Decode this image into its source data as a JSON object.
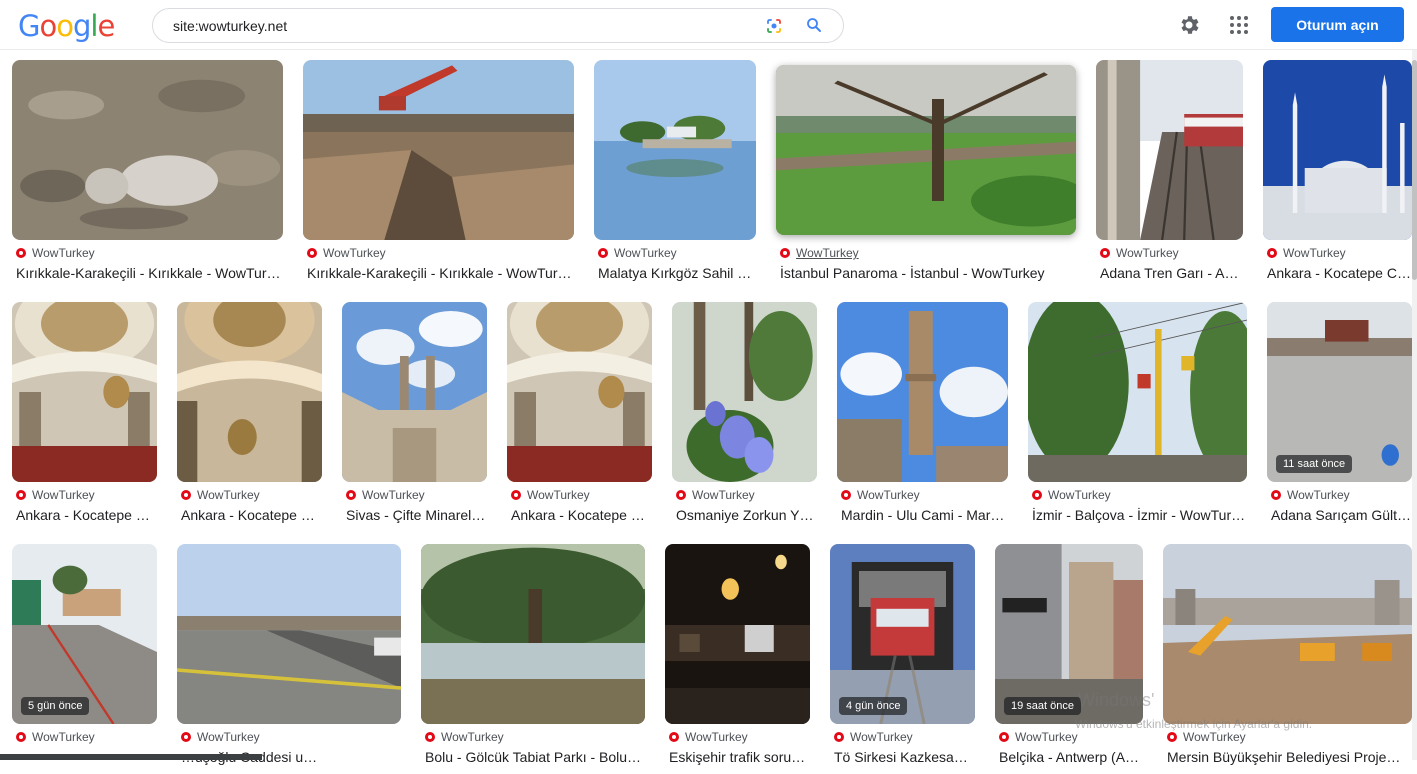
{
  "search": {
    "query": "site:wowturkey.net"
  },
  "header": {
    "logo": "Google",
    "signin_label": "Oturum açın"
  },
  "results": [
    {
      "source": "WowTurkey",
      "title": "Kırıkkale-Karakeçili - Kırıkkale - WowTur…",
      "badge": ""
    },
    {
      "source": "WowTurkey",
      "title": "Kırıkkale-Karakeçili - Kırıkkale - WowTur…",
      "badge": ""
    },
    {
      "source": "WowTurkey",
      "title": "Malatya Kırkgöz Sahil …",
      "badge": ""
    },
    {
      "source": "WowTurkey",
      "title": "İstanbul Panaroma - İstanbul - WowTurkey",
      "badge": ""
    },
    {
      "source": "WowTurkey",
      "title": "Adana Tren Garı - A…",
      "badge": ""
    },
    {
      "source": "WowTurkey",
      "title": "Ankara - Kocatepe C…",
      "badge": ""
    },
    {
      "source": "WowTurkey",
      "title": "Ankara - Kocatepe …",
      "badge": ""
    },
    {
      "source": "WowTurkey",
      "title": "Ankara - Kocatepe …",
      "badge": ""
    },
    {
      "source": "WowTurkey",
      "title": "Sivas - Çifte Minarel…",
      "badge": ""
    },
    {
      "source": "WowTurkey",
      "title": "Ankara - Kocatepe …",
      "badge": ""
    },
    {
      "source": "WowTurkey",
      "title": "Osmaniye Zorkun Y…",
      "badge": ""
    },
    {
      "source": "WowTurkey",
      "title": "Mardin - Ulu Cami - Mar…",
      "badge": ""
    },
    {
      "source": "WowTurkey",
      "title": "İzmir - Balçova - İzmir - WowTur…",
      "badge": ""
    },
    {
      "source": "WowTurkey",
      "title": "Adana Sarıçam Gült…",
      "badge": "11 saat önce"
    },
    {
      "source": "WowTurkey",
      "title": "",
      "badge": "5 gün önce"
    },
    {
      "source": "WowTurkey",
      "title": "…uşoğlu Caddesi u…",
      "badge": ""
    },
    {
      "source": "WowTurkey",
      "title": "Bolu - Gölcük Tabiat Parkı - Bolu…",
      "badge": ""
    },
    {
      "source": "WowTurkey",
      "title": "Eskişehir trafik soru…",
      "badge": ""
    },
    {
      "source": "WowTurkey",
      "title": "Tö Sirkesi Kazkesa…",
      "badge": "4 gün önce"
    },
    {
      "source": "WowTurkey",
      "title": "Belçika - Antwerp (A…",
      "badge": "19 saat önce"
    },
    {
      "source": "WowTurkey",
      "title": "Mersin Büyükşehir Belediyesi Proje…",
      "badge": ""
    }
  ],
  "watermark": {
    "line1": "Windows'",
    "line2": "Windows'u etkinleştirmek için Ayarlar'a gidin."
  }
}
